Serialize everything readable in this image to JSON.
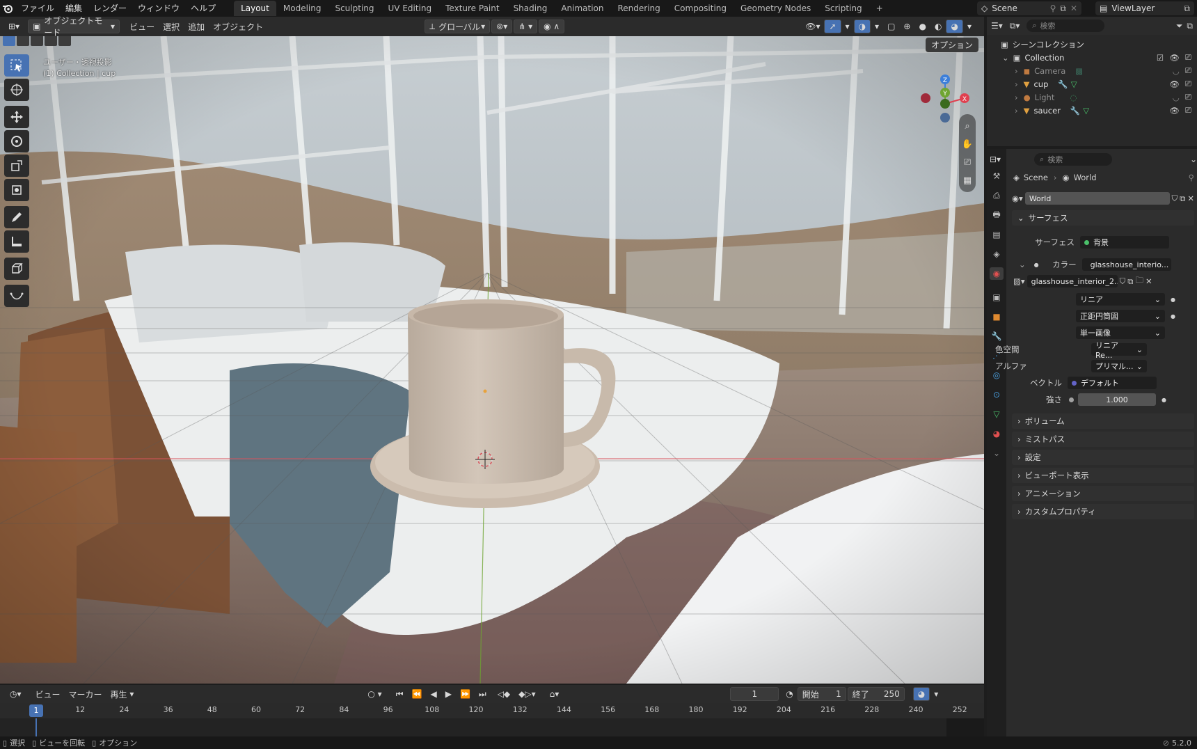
{
  "topbar": {
    "menus": [
      "ファイル",
      "編集",
      "レンダー",
      "ウィンドウ",
      "ヘルプ"
    ],
    "workspaces": [
      "Layout",
      "Modeling",
      "Sculpting",
      "UV Editing",
      "Texture Paint",
      "Shading",
      "Animation",
      "Rendering",
      "Compositing",
      "Geometry Nodes",
      "Scripting"
    ],
    "active_workspace": "Layout",
    "scene_name": "Scene",
    "view_layer": "ViewLayer"
  },
  "viewport_header": {
    "mode": "オブジェクトモード",
    "menus": [
      "ビュー",
      "選択",
      "追加",
      "オブジェクト"
    ],
    "transform_orientation": "グローバル",
    "options_label": "オプション"
  },
  "viewport": {
    "view_name": "ユーザー・透視投影",
    "collection_info": "(1) Collection | cup",
    "gizmo_axes": [
      "Z",
      "Y",
      "X"
    ]
  },
  "timeline": {
    "menus": [
      "ビュー",
      "マーカー",
      "再生"
    ],
    "current_frame": "1",
    "start_label": "開始",
    "start": "1",
    "end_label": "終了",
    "end": "250",
    "ticks": [
      "12",
      "24",
      "36",
      "48",
      "60",
      "72",
      "84",
      "96",
      "108",
      "120",
      "132",
      "144",
      "156",
      "168",
      "180",
      "192",
      "204",
      "216",
      "228",
      "240",
      "252"
    ],
    "playhead_label": "1"
  },
  "statusbar": {
    "items": [
      "選択",
      "ビューを回転",
      "オプション"
    ],
    "version": "5.2.0"
  },
  "outliner": {
    "search_placeholder": "検索",
    "root": "シーンコレクション",
    "collection": "Collection",
    "objects": [
      {
        "name": "Camera",
        "visible": false
      },
      {
        "name": "cup",
        "visible": true
      },
      {
        "name": "Light",
        "visible": false
      },
      {
        "name": "saucer",
        "visible": true
      }
    ]
  },
  "properties": {
    "search_placeholder": "検索",
    "breadcrumb": [
      "Scene",
      "World"
    ],
    "world_name": "World",
    "surface_section": "サーフェス",
    "surface_label": "サーフェス",
    "surface_value": "背景",
    "color_label": "カラー",
    "color_value": "glasshouse_interio...",
    "image_name": "glasshouse_interior_2...",
    "interpolation": "リニア",
    "projection": "正距円筒図",
    "source": "単一画像",
    "colorspace_label": "色空間",
    "colorspace_value": "リニア Re...",
    "alpha_label": "アルファ",
    "alpha_value": "プリマル...",
    "vector_label": "ベクトル",
    "vector_value": "デフォルト",
    "strength_label": "強さ",
    "strength_value": "1.000",
    "sections": [
      "ボリューム",
      "ミストパス",
      "設定",
      "ビューポート表示",
      "アニメーション",
      "カスタムプロパティ"
    ]
  },
  "colors": {
    "accent": "#4772b3",
    "x_axis": "#e0404f",
    "y_axis": "#6fa532",
    "z_axis": "#3d7fd9"
  }
}
